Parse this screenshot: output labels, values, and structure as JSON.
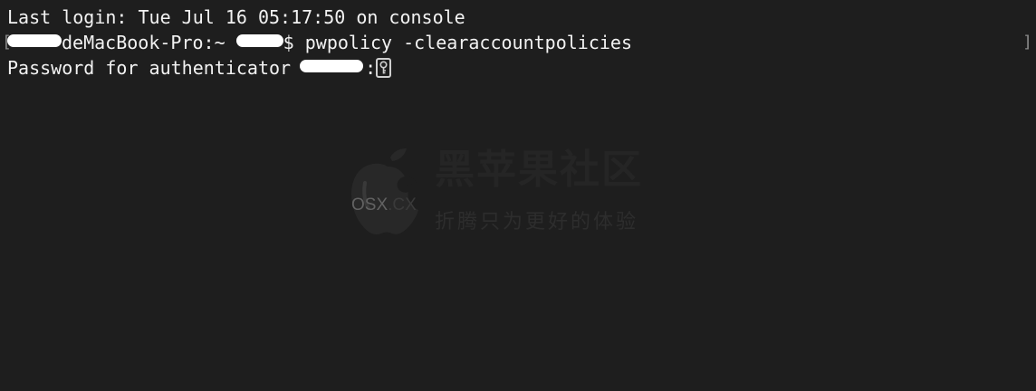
{
  "terminal": {
    "line1": "Last login: Tue Jul 16 05:17:50 on console",
    "line2_host": "deMacBook-Pro:~",
    "line2_prompt": "$ pwpolicy -clearaccountpolicies",
    "line3_prefix": "Password for authenticator",
    "line3_suffix": ":",
    "bracket_left": "[",
    "bracket_right": "]"
  },
  "watermark": {
    "logo_text_main": "OSX",
    "logo_text_tld": ".CX",
    "title": "黑苹果社区",
    "subtitle": "折腾只为更好的体验"
  },
  "colors": {
    "background": "#1e1e1e",
    "text": "#f2f2f2",
    "watermark": "#262626"
  },
  "icons": {
    "cursor": "key-icon",
    "logo": "bitten-apple-logo"
  }
}
